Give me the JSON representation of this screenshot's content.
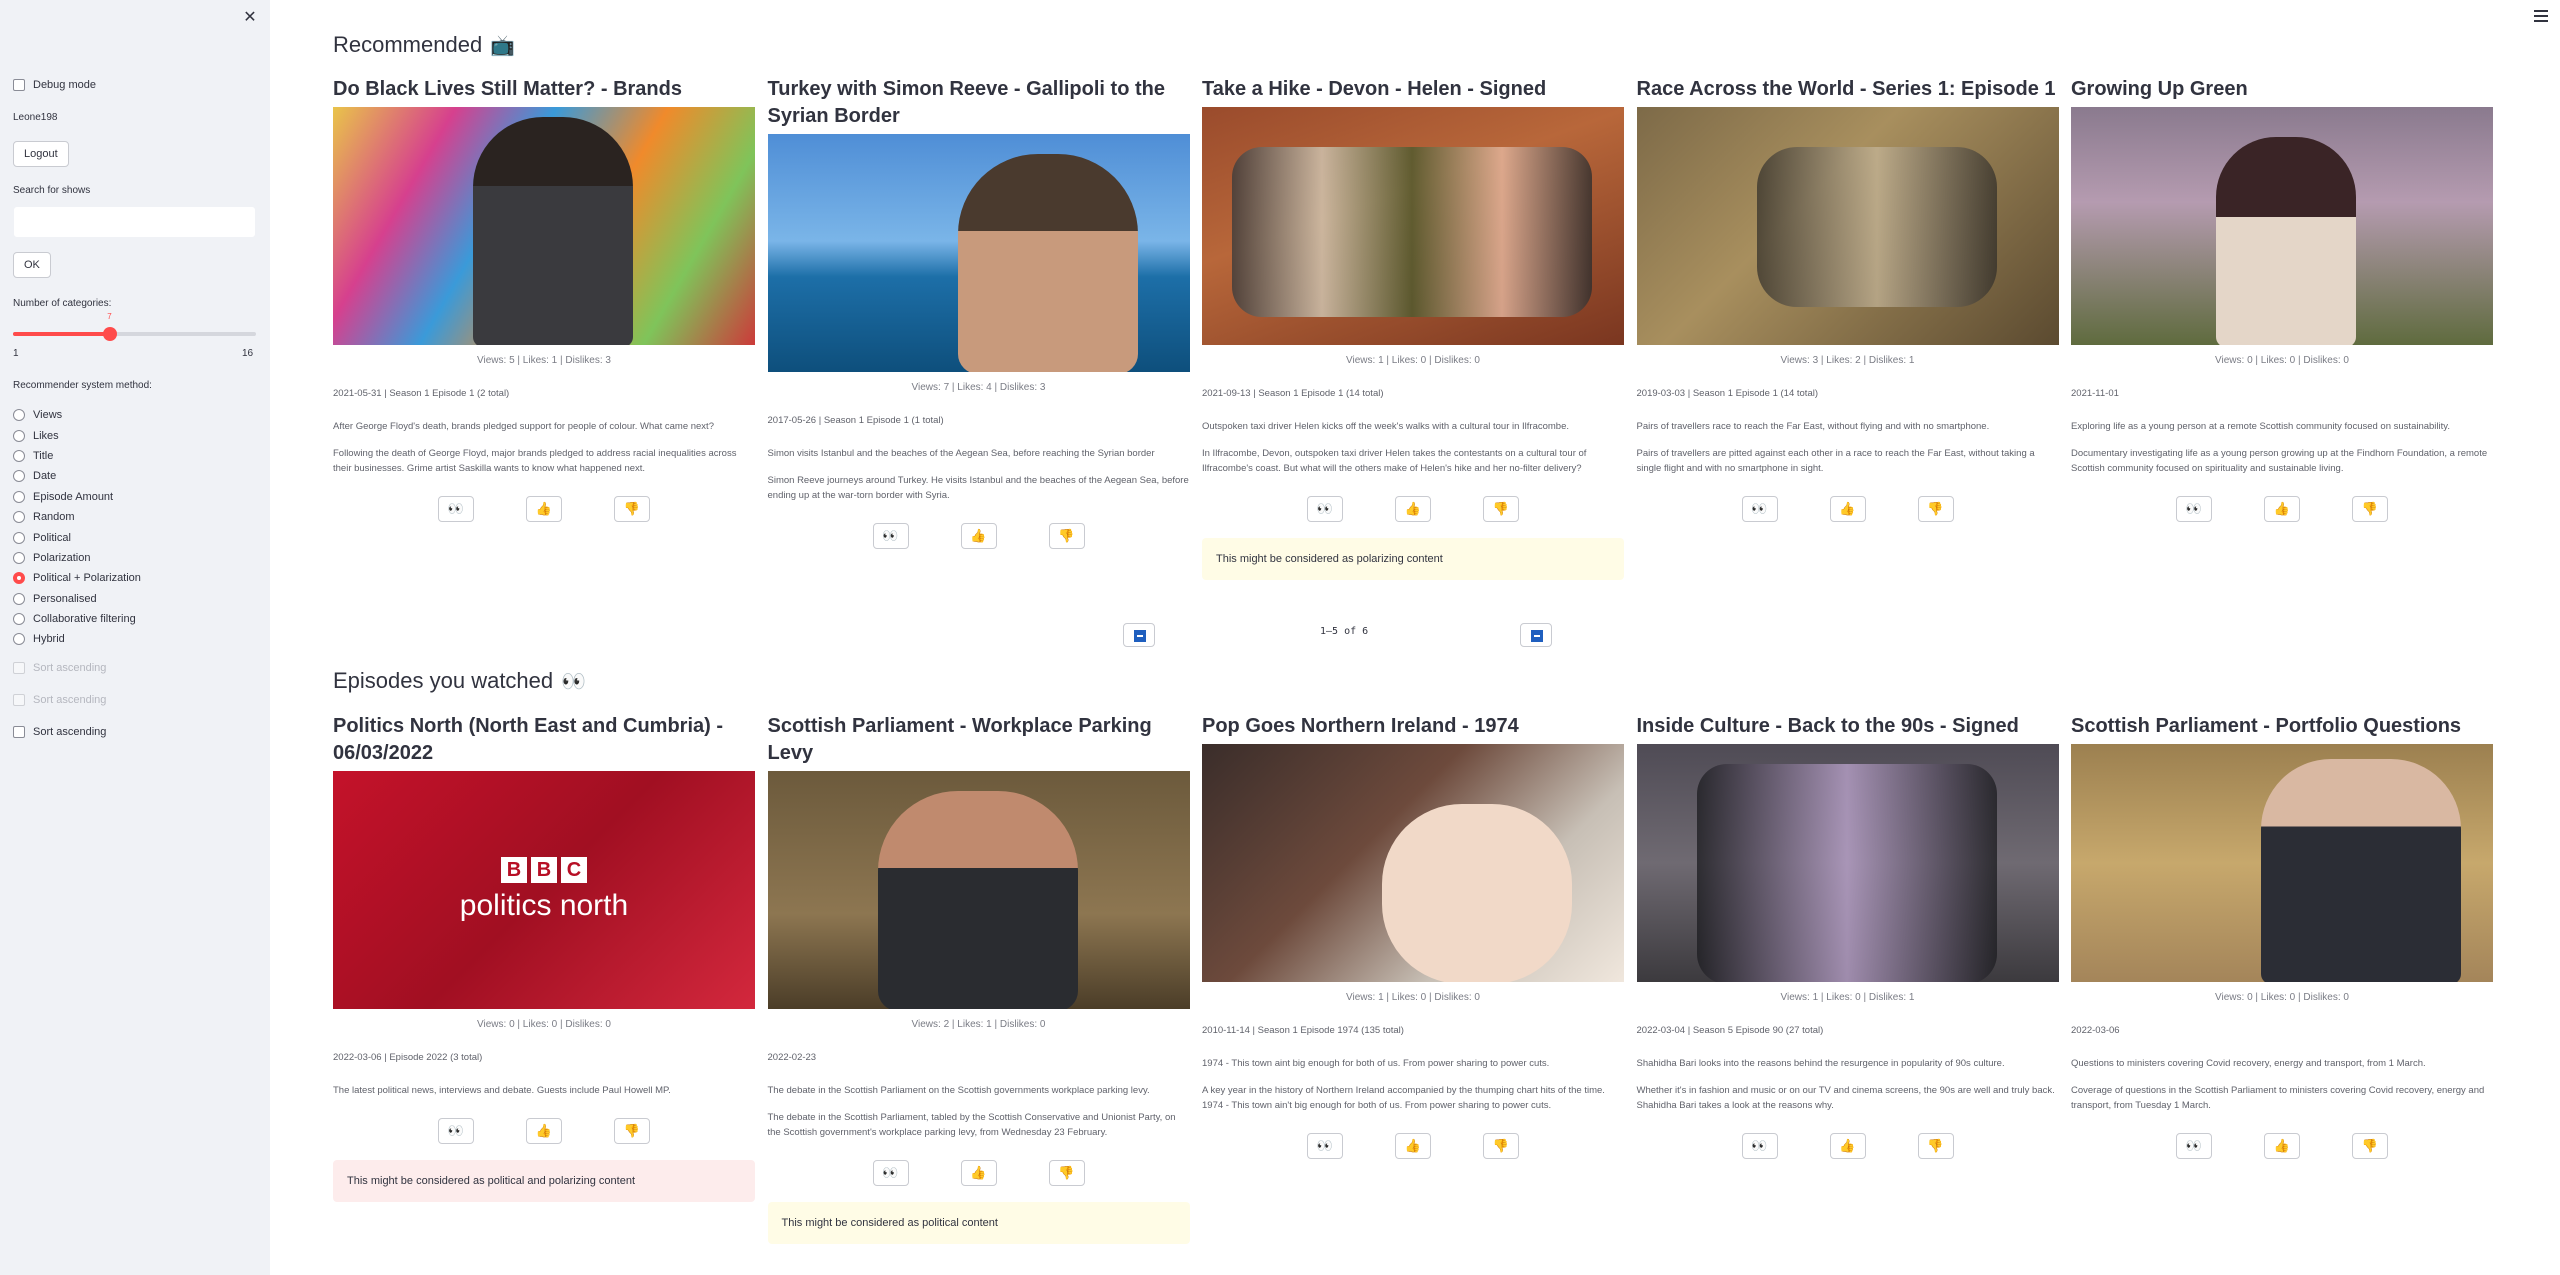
{
  "sidebar": {
    "debug_label": "Debug mode",
    "username": "Leone198",
    "logout_label": "Logout",
    "search_label": "Search for shows",
    "search_value": "",
    "ok_label": "OK",
    "categories_label": "Number of categories:",
    "slider": {
      "value": "7",
      "min": "1",
      "max": "16"
    },
    "method_label": "Recommender system method:",
    "methods": [
      "Views",
      "Likes",
      "Title",
      "Date",
      "Episode Amount",
      "Random",
      "Political",
      "Polarization",
      "Political + Polarization",
      "Personalised",
      "Collaborative filtering",
      "Hybrid"
    ],
    "selected_method": "Political + Polarization",
    "sort1": "Sort ascending",
    "sort2": "Sort ascending",
    "sort3": "Sort ascending"
  },
  "recommended": {
    "title": "Recommended",
    "emoji": "📺",
    "pager": "1–5 of 6",
    "cards": [
      {
        "title": "Do Black Lives Still Matter? - Brands",
        "stats": "Views: 5 | Likes: 1 | Dislikes: 3",
        "meta": "2021-05-31 | Season 1 Episode 1 (2 total)",
        "desc": "After George Floyd's death, brands pledged support for people of colour. What came next?",
        "desc2": "Following the death of George Floyd, major brands pledged to address racial inequalities across their businesses. Grime artist Saskilla wants to know what happened next."
      },
      {
        "title": "Turkey with Simon Reeve - Gallipoli to the Syrian Border",
        "stats": "Views: 7 | Likes: 4 | Dislikes: 3",
        "meta": "2017-05-26 | Season 1 Episode 1 (1 total)",
        "desc": "Simon visits Istanbul and the beaches of the Aegean Sea, before reaching the Syrian border",
        "desc2": "Simon Reeve journeys around Turkey. He visits Istanbul and the beaches of the Aegean Sea, before ending up at the war-torn border with Syria."
      },
      {
        "title": "Take a Hike - Devon - Helen - Signed",
        "stats": "Views: 1 | Likes: 0 | Dislikes: 0",
        "meta": "2021-09-13 | Season 1 Episode 1 (14 total)",
        "desc": "Outspoken taxi driver Helen kicks off the week's walks with a cultural tour in Ilfracombe.",
        "desc2": "In Ilfracombe, Devon, outspoken taxi driver Helen takes the contestants on a cultural tour of Ilfracombe's coast. But what will the others make of Helen's hike and her no-filter delivery?",
        "warning": "This might be considered as polarizing content"
      },
      {
        "title": "Race Across the World - Series 1: Episode 1",
        "stats": "Views: 3 | Likes: 2 | Dislikes: 1",
        "meta": "2019-03-03 | Season 1 Episode 1 (14 total)",
        "desc": "Pairs of travellers race to reach the Far East, without flying and with no smartphone.",
        "desc2": "Pairs of travellers are pitted against each other in a race to reach the Far East, without taking a single flight and with no smartphone in sight."
      },
      {
        "title": "Growing Up Green",
        "stats": "Views: 0 | Likes: 0 | Dislikes: 0",
        "meta": "2021-11-01",
        "desc": "Exploring life as a young person at a remote Scottish community focused on sustainability.",
        "desc2": "Documentary investigating life as a young person growing up at the Findhorn Foundation, a remote Scottish community focused on spirituality and sustainable living."
      }
    ]
  },
  "watched": {
    "title": "Episodes you watched",
    "emoji": "👀",
    "cards": [
      {
        "title": "Politics North (North East and Cumbria) - 06/03/2022",
        "stats": "Views: 0 | Likes: 0 | Dislikes: 0",
        "meta": "2022-03-06 | Episode 2022 (3 total)",
        "desc": "The latest political news, interviews and debate. Guests include Paul Howell MP.",
        "warning": "This might be considered as political and polarizing content",
        "logo_letters": [
          "B",
          "B",
          "C"
        ],
        "logo_text": "politics north"
      },
      {
        "title": "Scottish Parliament - Workplace Parking Levy",
        "stats": "Views: 2 | Likes: 1 | Dislikes: 0",
        "meta": "2022-02-23",
        "desc": "The debate in the Scottish Parliament on the Scottish governments workplace parking levy.",
        "desc2": "The debate in the Scottish Parliament, tabled by the Scottish Conservative and Unionist Party, on the Scottish government's workplace parking levy, from Wednesday 23 February.",
        "warning": "This might be considered as political content"
      },
      {
        "title": "Pop Goes Northern Ireland - 1974",
        "stats": "Views: 1 | Likes: 0 | Dislikes: 0",
        "meta": "2010-11-14 | Season 1 Episode 1974 (135 total)",
        "desc": "1974 - This town aint big enough for both of us. From power sharing to power cuts.",
        "desc2": "A key year in the history of Northern Ireland accompanied by the thumping chart hits of the time. 1974 - This town ain't big enough for both of us. From power sharing to power cuts."
      },
      {
        "title": "Inside Culture - Back to the 90s - Signed",
        "stats": "Views: 1 | Likes: 0 | Dislikes: 1",
        "meta": "2022-03-04 | Season 5 Episode 90 (27 total)",
        "desc": "Shahidha Bari looks into the reasons behind the resurgence in popularity of 90s culture.",
        "desc2": "Whether it's in fashion and music or on our TV and cinema screens, the 90s are well and truly back. Shahidha Bari takes a look at the reasons why."
      },
      {
        "title": "Scottish Parliament - Portfolio Questions",
        "stats": "Views: 0 | Likes: 0 | Dislikes: 0",
        "meta": "2022-03-06",
        "desc": "Questions to ministers covering Covid recovery, energy and transport, from 1 March.",
        "desc2": "Coverage of questions in the Scottish Parliament to ministers covering Covid recovery, energy and transport, from Tuesday 1 March."
      }
    ]
  },
  "icons": {
    "view": "eyes-icon",
    "like": "thumbs-up-icon",
    "dislike": "thumbs-down-icon"
  },
  "colors": {
    "accent": "#ff4b4b",
    "warning_yellow": "#fffce6",
    "warning_red": "#fdecec"
  }
}
